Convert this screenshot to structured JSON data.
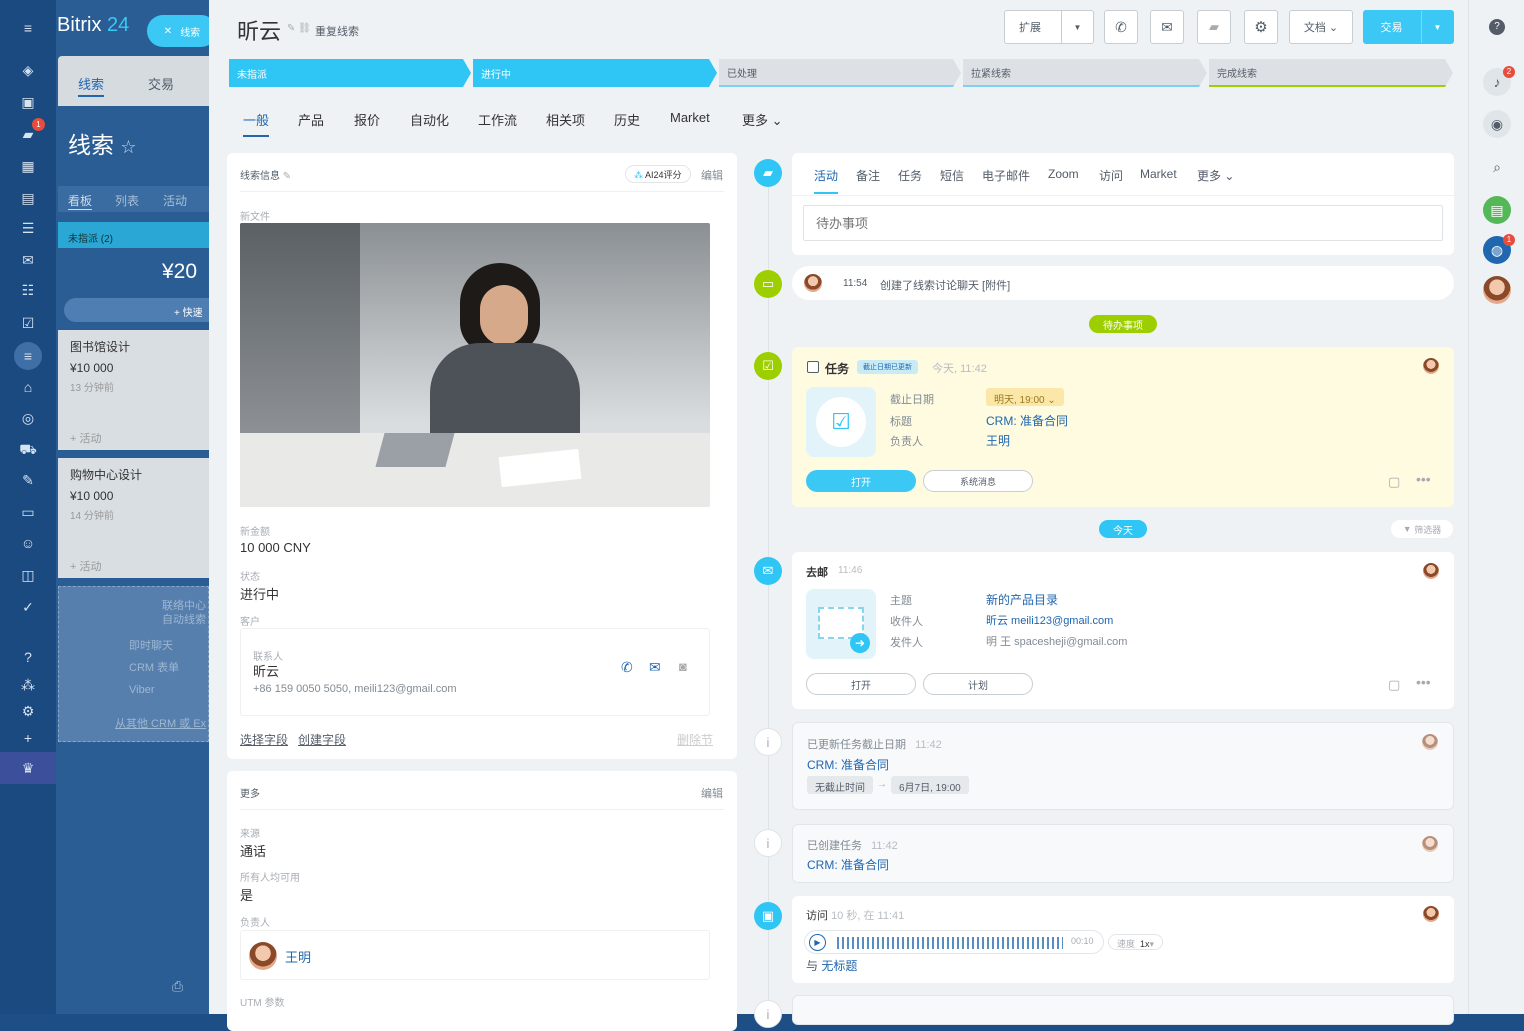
{
  "brand": {
    "name": "Bitrix",
    "num": "24",
    "close_tab": "线索"
  },
  "bg": {
    "tabs": [
      "线索",
      "交易"
    ],
    "title": "线索",
    "views": [
      "看板",
      "列表",
      "活动"
    ],
    "column": "未指派 (2)",
    "amount": "¥20",
    "quick": "+ 快速",
    "cards": [
      {
        "title": "图书馆设计",
        "price": "¥10 000",
        "time": "13 分钟前",
        "act": "+ 活动"
      },
      {
        "title": "购物中心设计",
        "price": "¥10 000",
        "time": "14 分钟前",
        "act": "+ 活动"
      }
    ],
    "connect": [
      "联络中心",
      "自动线索"
    ],
    "channels": [
      "即时聊天",
      "CRM 表单",
      "Viber"
    ],
    "import": "从其他 CRM 或 Ex"
  },
  "header": {
    "title": "昕云",
    "dup": "重复线索",
    "expand": "扩展",
    "docs": "文档",
    "deal": "交易"
  },
  "stages": [
    "未指派",
    "进行中",
    "已处理",
    "拉紧线索",
    "完成线索"
  ],
  "tabs": [
    "一般",
    "产品",
    "报价",
    "自动化",
    "工作流",
    "相关项",
    "历史",
    "Market",
    "更多"
  ],
  "info": {
    "title": "线索信息",
    "ai": "AI24评分",
    "edit": "编辑",
    "file_label": "新文件",
    "amount_label": "新金额",
    "amount": "10 000 CNY",
    "status_label": "状态",
    "status": "进行中",
    "client_label": "客户",
    "contact_label": "联系人",
    "contact_name": "昕云",
    "contact_info": "+86 159 0050 5050, meili123@gmail.com",
    "select_field": "选择字段",
    "create_field": "创建字段",
    "delete": "删除节"
  },
  "more": {
    "title": "更多",
    "edit": "编辑",
    "source_label": "来源",
    "source": "通话",
    "avail_label": "所有人均可用",
    "avail": "是",
    "resp_label": "负责人",
    "resp": "王明",
    "utm_label": "UTM 参数"
  },
  "act_tabs": [
    "活动",
    "备注",
    "任务",
    "短信",
    "电子邮件",
    "Zoom",
    "访问",
    "Market",
    "更多"
  ],
  "todo_placeholder": "待办事项",
  "chat": {
    "time": "11:54",
    "text": "创建了线索讨论聊天 [附件]"
  },
  "todo_badge": "待办事项",
  "task": {
    "title": "任务",
    "badge": "截止日期已更新",
    "time": "今天, 11:42",
    "deadline_label": "截止日期",
    "deadline": "明天, 19:00",
    "title_label": "标题",
    "title_val": "CRM: 准备合同",
    "resp_label": "负责人",
    "resp": "王明",
    "open": "打开",
    "sys": "系统消息"
  },
  "today": "今天",
  "filter": "筛选器",
  "mail": {
    "title": "去邮",
    "time": "11:46",
    "subj_label": "主题",
    "subj": "新的产品目录",
    "to_label": "收件人",
    "to": "昕云 meili123@gmail.com",
    "from_label": "发件人",
    "from": "明 王 spacesheji@gmail.com",
    "open": "打开",
    "plan": "计划"
  },
  "upd": {
    "title": "已更新任务截止日期",
    "time": "11:42",
    "link": "CRM: 准备合同",
    "from": "无截止时间",
    "to": "6月7日, 19:00"
  },
  "created": {
    "title": "已创建任务",
    "time": "11:42",
    "link": "CRM: 准备合同"
  },
  "visit": {
    "title": "访问",
    "time": "10 秒, 在 11:41",
    "dur": "00:10",
    "speed_label": "速度",
    "speed": "1x",
    "with": "与",
    "with_link": "无标题"
  },
  "badges": {
    "chat": "1",
    "bell": "2",
    "rb_chat": "1"
  }
}
